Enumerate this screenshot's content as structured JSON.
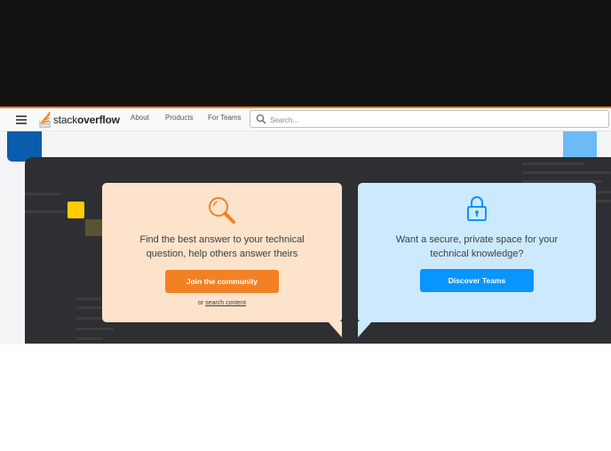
{
  "header": {
    "logo_text_light": "stack",
    "logo_text_bold": "overflow",
    "nav": [
      "About",
      "Products",
      "For Teams"
    ],
    "search_placeholder": "Search..."
  },
  "cards": {
    "community": {
      "line1": "Find the best answer to your technical",
      "line2": "question, help others answer theirs",
      "button": "Join the community",
      "or_prefix": "or",
      "link": "search content",
      "icon": "magnifier-icon"
    },
    "teams": {
      "line1": "Want a secure, private space for your",
      "line2": "technical knowledge?",
      "button": "Discover Teams",
      "icon": "lock-icon"
    }
  },
  "colors": {
    "brand_orange": "#f48024",
    "teams_blue": "#0995ff",
    "community_bg": "#fde3cc",
    "teams_bg": "#cde9fe",
    "dark_panel": "#2d2f32"
  }
}
